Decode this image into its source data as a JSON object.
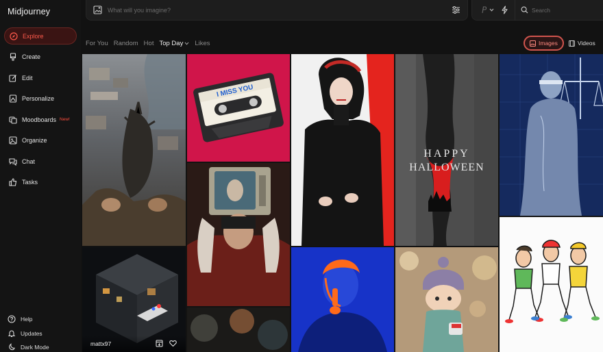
{
  "app": {
    "title": "Midjourney"
  },
  "sidebar": {
    "items": [
      {
        "label": "Explore",
        "icon": "compass-icon",
        "active": true
      },
      {
        "label": "Create",
        "icon": "brush-icon"
      },
      {
        "label": "Edit",
        "icon": "edit-icon"
      },
      {
        "label": "Personalize",
        "icon": "personalize-icon"
      },
      {
        "label": "Moodboards",
        "icon": "moodboard-icon",
        "badge": "New!"
      },
      {
        "label": "Organize",
        "icon": "organize-icon"
      },
      {
        "label": "Chat",
        "icon": "chat-icon"
      },
      {
        "label": "Tasks",
        "icon": "thumbs-up-icon"
      }
    ],
    "bottom": [
      {
        "label": "Help",
        "icon": "help-icon"
      },
      {
        "label": "Updates",
        "icon": "bell-icon"
      },
      {
        "label": "Dark Mode",
        "icon": "moon-icon"
      }
    ]
  },
  "prompt": {
    "placeholder": "What will you imagine?"
  },
  "search": {
    "placeholder": "Search"
  },
  "tabs": [
    {
      "label": "For You",
      "active": false
    },
    {
      "label": "Random",
      "active": false
    },
    {
      "label": "Hot",
      "active": false
    },
    {
      "label": "Top Day",
      "active": true,
      "dropdown": true
    },
    {
      "label": "Likes",
      "active": false
    }
  ],
  "media_toggle": {
    "images_label": "Images",
    "videos_label": "Videos",
    "active": "Images"
  },
  "accent_color": "#ff4d3d",
  "gallery": {
    "tiles": [
      {
        "subject": "dragon-over-city"
      },
      {
        "subject": "cassette-tape",
        "text": "I MISS YOU"
      },
      {
        "subject": "woman-in-black"
      },
      {
        "subject": "happy-halloween",
        "text_line1": "HAPPY",
        "text_line2": "HALLOWEEN"
      },
      {
        "subject": "lady-justice-blueprint"
      },
      {
        "subject": "isometric-night-street",
        "user": "mattx97"
      },
      {
        "subject": "tv-head-person"
      },
      {
        "subject": "blue-orange-man"
      },
      {
        "subject": "knit-doll"
      },
      {
        "subject": "cartoon-runners"
      },
      {
        "subject": "blurred-lights"
      }
    ]
  }
}
